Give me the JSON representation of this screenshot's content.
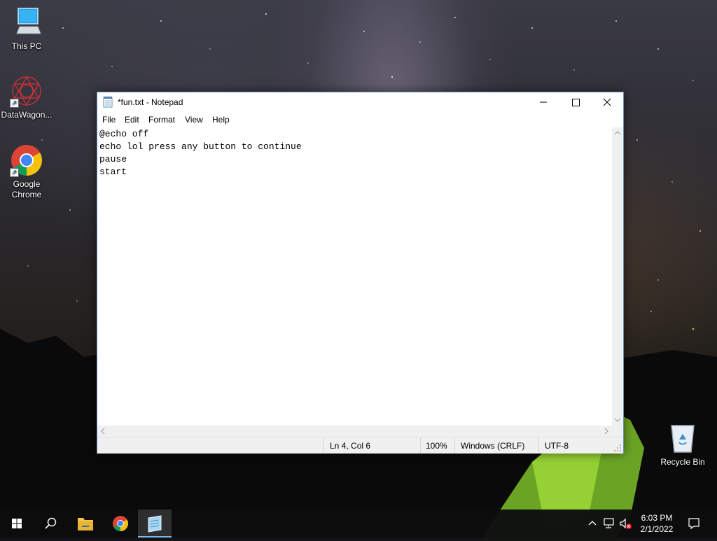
{
  "desktop": {
    "icons": [
      {
        "label": "This PC"
      },
      {
        "label": "DataWagon..."
      },
      {
        "label": "Google\nChrome"
      },
      {
        "label": "Recycle Bin"
      }
    ]
  },
  "window": {
    "title": "*fun.txt - Notepad",
    "menu": [
      "File",
      "Edit",
      "Format",
      "View",
      "Help"
    ],
    "content_lines": [
      "@echo off",
      "echo lol press any button to continue",
      "pause",
      "start"
    ],
    "status": {
      "position": "Ln 4, Col 6",
      "zoom": "100%",
      "line_ending": "Windows (CRLF)",
      "encoding": "UTF-8"
    }
  },
  "taskbar": {
    "clock_time": "6:03 PM",
    "clock_date": "2/1/2022"
  },
  "colors": {
    "accent": "#76b9ed",
    "folder": "#f6c445",
    "chrome_red": "#db4437",
    "chrome_yellow": "#f4c20d",
    "chrome_green": "#0f9d58",
    "chrome_blue": "#4285f4"
  }
}
